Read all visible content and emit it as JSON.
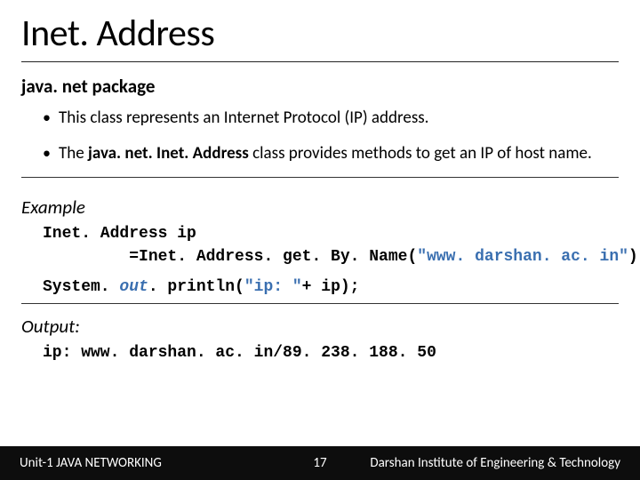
{
  "title": "Inet. Address",
  "subtitle": "java. net package",
  "bullets": [
    "This class represents an Internet Protocol (IP) address.",
    {
      "pre": "The ",
      "bold": "java. net. Inet. Address",
      "post": " class provides methods to get an IP of host name."
    }
  ],
  "example_label": "Example",
  "code": {
    "line1": "Inet. Address ip",
    "line2_pre": "         =Inet. Address. get. By. Name(",
    "line2_str": "\"www. darshan. ac. in\"",
    "line2_post": ");",
    "line3_a": "System. ",
    "line3_out": "out",
    "line3_b": ". println(",
    "line3_str": "\"ip: \"",
    "line3_c": "+ ip);"
  },
  "output_label": "Output:",
  "output_line": "ip: www. darshan. ac. in/89. 238. 188. 50",
  "footer": {
    "left": "Unit-1 JAVA NETWORKING",
    "center": "17",
    "right": "Darshan Institute of Engineering & Technology"
  }
}
